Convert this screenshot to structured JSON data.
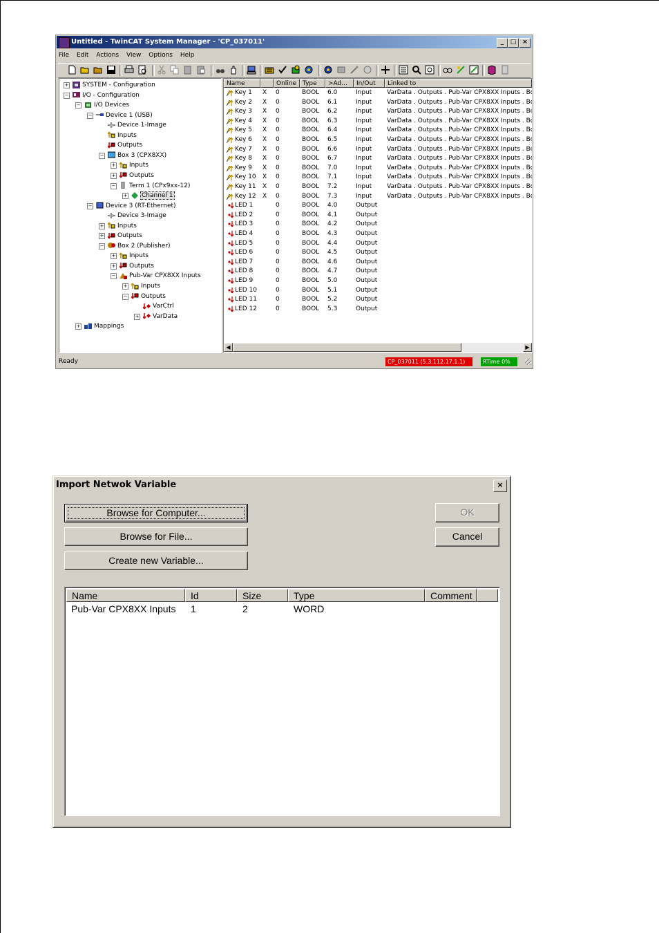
{
  "window": {
    "title": "Untitled - TwinCAT System Manager - 'CP_037011'",
    "menu": [
      "File",
      "Edit",
      "Actions",
      "View",
      "Options",
      "Help"
    ],
    "caption_buttons": [
      "_",
      "□",
      "×"
    ]
  },
  "tree": [
    {
      "label": "SYSTEM - Configuration",
      "icon": "system-icon",
      "exp": "+"
    },
    {
      "label": "I/O - Configuration",
      "icon": "io-config-icon",
      "exp": "−"
    },
    {
      "label": "I/O Devices",
      "icon": "io-devices-icon",
      "exp": "−"
    },
    {
      "label": "Device 1 (USB)",
      "icon": "usb-device-icon",
      "exp": "−"
    },
    {
      "label": "Device 1-Image",
      "icon": "image-icon",
      "exp": ""
    },
    {
      "label": "Inputs",
      "icon": "inputs-icon",
      "exp": ""
    },
    {
      "label": "Outputs",
      "icon": "outputs-icon",
      "exp": ""
    },
    {
      "label": "Box 3 (CPX8XX)",
      "icon": "box-icon",
      "exp": "−"
    },
    {
      "label": "Inputs",
      "icon": "inputs-icon",
      "exp": "+"
    },
    {
      "label": "Outputs",
      "icon": "outputs-icon",
      "exp": "+"
    },
    {
      "label": "Term 1 (CPx9xx-12)",
      "icon": "terminal-icon",
      "exp": "−"
    },
    {
      "label": "Channel 1",
      "icon": "channel-icon",
      "exp": "+"
    },
    {
      "label": "Device 3 (RT-Ethernet)",
      "icon": "ethernet-device-icon",
      "exp": "−"
    },
    {
      "label": "Device 3-Image",
      "icon": "image-icon",
      "exp": ""
    },
    {
      "label": "Inputs",
      "icon": "inputs-icon",
      "exp": "+"
    },
    {
      "label": "Outputs",
      "icon": "outputs-icon",
      "exp": "+"
    },
    {
      "label": "Box 2 (Publisher)",
      "icon": "publisher-icon",
      "exp": "−"
    },
    {
      "label": "Inputs",
      "icon": "inputs-icon",
      "exp": "+"
    },
    {
      "label": "Outputs",
      "icon": "outputs-icon",
      "exp": "+"
    },
    {
      "label": "Pub-Var CPX8XX Inputs",
      "icon": "pubvar-icon",
      "exp": "−"
    },
    {
      "label": "Inputs",
      "icon": "inputs-icon",
      "exp": "+"
    },
    {
      "label": "Outputs",
      "icon": "outputs-icon",
      "exp": "−"
    },
    {
      "label": "VarCtrl",
      "icon": "output-var-icon",
      "exp": ""
    },
    {
      "label": "VarData",
      "icon": "output-var-icon",
      "exp": "+"
    },
    {
      "label": "Mappings",
      "icon": "mappings-icon",
      "exp": "+"
    }
  ],
  "list": {
    "columns": [
      "Name",
      "",
      "Online",
      "Type",
      ">Ad...",
      "In/Out",
      "Linked to"
    ],
    "rows": [
      [
        "Key 1",
        "X",
        "0",
        "BOOL",
        "6.0",
        "Input",
        "VarData . Outputs . Pub-Var CPX8XX Inputs . Bo"
      ],
      [
        "Key 2",
        "X",
        "0",
        "BOOL",
        "6.1",
        "Input",
        "VarData . Outputs . Pub-Var CPX8XX Inputs . Bo"
      ],
      [
        "Key 3",
        "X",
        "0",
        "BOOL",
        "6.2",
        "Input",
        "VarData . Outputs . Pub-Var CPX8XX Inputs . Bo"
      ],
      [
        "Key 4",
        "X",
        "0",
        "BOOL",
        "6.3",
        "Input",
        "VarData . Outputs . Pub-Var CPX8XX Inputs . Bo"
      ],
      [
        "Key 5",
        "X",
        "0",
        "BOOL",
        "6.4",
        "Input",
        "VarData . Outputs . Pub-Var CPX8XX Inputs . Bo"
      ],
      [
        "Key 6",
        "X",
        "0",
        "BOOL",
        "6.5",
        "Input",
        "VarData . Outputs . Pub-Var CPX8XX Inputs . Bo"
      ],
      [
        "Key 7",
        "X",
        "0",
        "BOOL",
        "6.6",
        "Input",
        "VarData . Outputs . Pub-Var CPX8XX Inputs . Bo"
      ],
      [
        "Key 8",
        "X",
        "0",
        "BOOL",
        "6.7",
        "Input",
        "VarData . Outputs . Pub-Var CPX8XX Inputs . Bo"
      ],
      [
        "Key 9",
        "X",
        "0",
        "BOOL",
        "7.0",
        "Input",
        "VarData . Outputs . Pub-Var CPX8XX Inputs . Bo"
      ],
      [
        "Key 10",
        "X",
        "0",
        "BOOL",
        "7.1",
        "Input",
        "VarData . Outputs . Pub-Var CPX8XX Inputs . Bo"
      ],
      [
        "Key 11",
        "X",
        "0",
        "BOOL",
        "7.2",
        "Input",
        "VarData . Outputs . Pub-Var CPX8XX Inputs . Bo"
      ],
      [
        "Key 12",
        "X",
        "0",
        "BOOL",
        "7.3",
        "Input",
        "VarData . Outputs . Pub-Var CPX8XX Inputs . Bo"
      ],
      [
        "LED 1",
        "",
        "0",
        "BOOL",
        "4.0",
        "Output",
        ""
      ],
      [
        "LED 2",
        "",
        "0",
        "BOOL",
        "4.1",
        "Output",
        ""
      ],
      [
        "LED 3",
        "",
        "0",
        "BOOL",
        "4.2",
        "Output",
        ""
      ],
      [
        "LED 4",
        "",
        "0",
        "BOOL",
        "4.3",
        "Output",
        ""
      ],
      [
        "LED 5",
        "",
        "0",
        "BOOL",
        "4.4",
        "Output",
        ""
      ],
      [
        "LED 6",
        "",
        "0",
        "BOOL",
        "4.5",
        "Output",
        ""
      ],
      [
        "LED 7",
        "",
        "0",
        "BOOL",
        "4.6",
        "Output",
        ""
      ],
      [
        "LED 8",
        "",
        "0",
        "BOOL",
        "4.7",
        "Output",
        ""
      ],
      [
        "LED 9",
        "",
        "0",
        "BOOL",
        "5.0",
        "Output",
        ""
      ],
      [
        "LED 10",
        "",
        "0",
        "BOOL",
        "5.1",
        "Output",
        ""
      ],
      [
        "LED 11",
        "",
        "0",
        "BOOL",
        "5.2",
        "Output",
        ""
      ],
      [
        "LED 12",
        "",
        "0",
        "BOOL",
        "5.3",
        "Output",
        ""
      ]
    ]
  },
  "status": {
    "text": "Ready",
    "target": "CP_037011 (5.3.112.17.1.1)",
    "target_color": "#e00000",
    "rtime": "RTime 0%",
    "rtime_color": "#00a000"
  },
  "dialog": {
    "title": "Import Netwok Variable",
    "close": "×",
    "buttons": {
      "browse_computer": "Browse for Computer...",
      "browse_file": "Browse for File...",
      "create_variable": "Create new Variable...",
      "ok": "OK",
      "cancel": "Cancel"
    },
    "columns": [
      "Name",
      "Id",
      "Size",
      "Type",
      "Comment"
    ],
    "rows": [
      [
        "Pub-Var CPX8XX Inputs",
        "1",
        "2",
        "WORD",
        ""
      ]
    ]
  }
}
